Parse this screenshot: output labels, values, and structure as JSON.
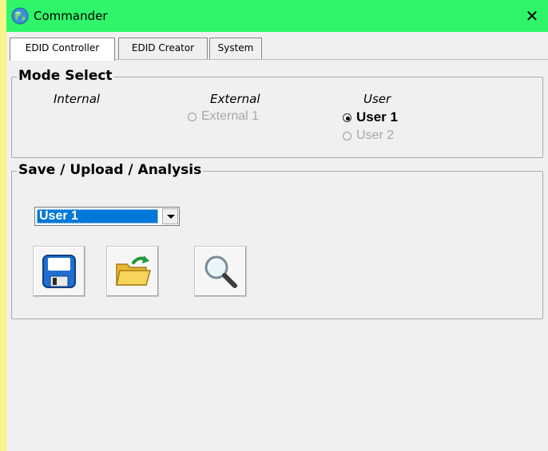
{
  "window": {
    "title": "Commander",
    "close_glyph": "✕",
    "titlebar_color": "#2ff56a",
    "icon": "globe-icon"
  },
  "tabs": [
    {
      "label": "EDID Controller",
      "active": true
    },
    {
      "label": "EDID Creator",
      "active": false
    },
    {
      "label": "System",
      "active": false
    }
  ],
  "mode_select": {
    "legend": "Mode Select",
    "columns": {
      "internal": "Internal",
      "external": "External",
      "user": "User"
    },
    "options": {
      "external_1": {
        "label": "External 1",
        "checked": false,
        "enabled": false
      },
      "user_1": {
        "label": "User 1",
        "checked": true,
        "enabled": true
      },
      "user_2": {
        "label": "User 2",
        "checked": false,
        "enabled": false
      }
    }
  },
  "save_upload": {
    "legend": "Save / Upload / Analysis",
    "combo_value": "User 1",
    "buttons": [
      "save-icon",
      "open-folder-icon",
      "magnifier-icon"
    ]
  },
  "colors": {
    "accent": "#0078d7",
    "panel": "#f0f0f0",
    "left_strip": "#f5f58a"
  }
}
